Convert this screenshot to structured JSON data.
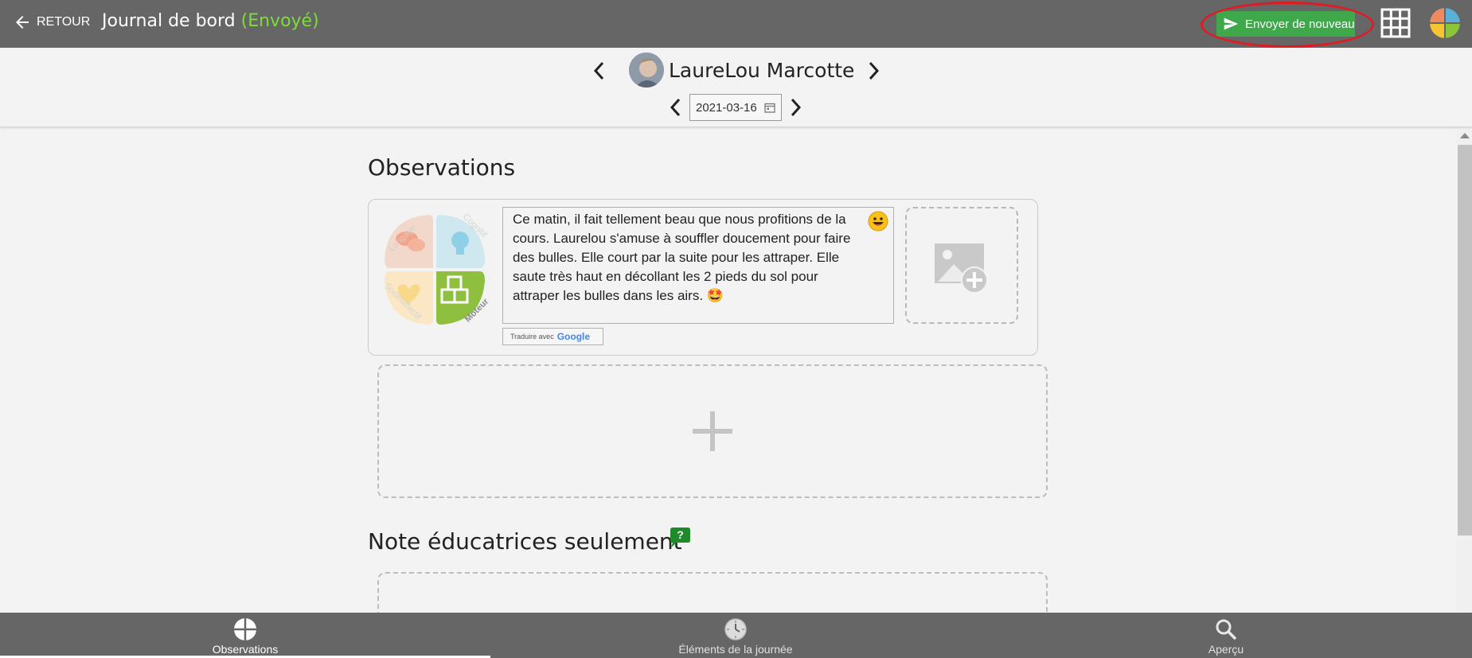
{
  "header": {
    "back_label": "RETOUR",
    "title": "Journal de bord",
    "status": "(Envoyé)",
    "send_button_label": "Envoyer de nouveau"
  },
  "child": {
    "name": "LaureLou Marcotte",
    "date": "2021-03-16"
  },
  "observations": {
    "section_title": "Observations",
    "text": "Ce matin, il fait tellement beau que nous profitions  de la cours. Laurelou s'amuse à souffler doucement pour faire des bulles. Elle court par la suite pour les attraper. Elle saute très haut en décollant les 2 pieds du sol pour attraper les bulles dans les airs. 🤩",
    "translate_prefix": "Traduire avec",
    "translate_brand": "Google",
    "wheel": {
      "quadrants": [
        "Langage",
        "Cognitif",
        "Socioaffectif",
        "Moteur"
      ]
    }
  },
  "notes": {
    "section_title": "Note éducatrices seulement"
  },
  "bottom_nav": {
    "tabs": [
      {
        "label": "Observations",
        "icon": "observations-wheel-icon",
        "active": true
      },
      {
        "label": "Éléments de la journée",
        "icon": "clock-icon",
        "active": false
      },
      {
        "label": "Aperçu",
        "icon": "search-icon",
        "active": false
      }
    ]
  },
  "colors": {
    "header_bg": "#666666",
    "status_green": "#7ddc3c",
    "send_button_green": "#3fa84a",
    "highlight_ring_red": "#e01b24"
  }
}
